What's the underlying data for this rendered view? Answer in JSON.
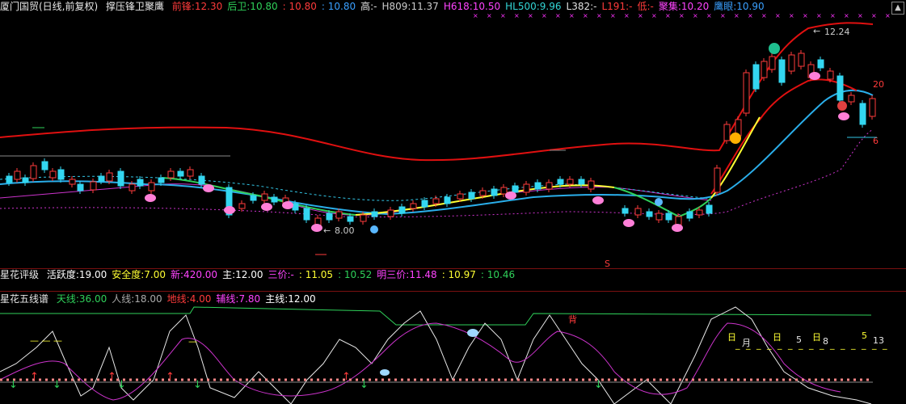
{
  "header": {
    "title": "厦门国贸(日线,前复权)",
    "indicator": "撑压锋卫聚鹰",
    "items": [
      {
        "label": "前锋:",
        "value": "12.30",
        "color": "#ff3b3b"
      },
      {
        "label": "后卫:",
        "value": "10.80",
        "color": "#2fd15a"
      },
      {
        "label": "",
        "value": ": 10.80",
        "color": "#ff3b3b"
      },
      {
        "label": "",
        "value": ": 10.80",
        "color": "#3aa0ff"
      },
      {
        "label": "高:",
        "value": "-",
        "color": "#e0e0e0"
      },
      {
        "label": "H809:",
        "value": "11.37",
        "color": "#cccccc"
      },
      {
        "label": "H618:",
        "value": "10.50",
        "color": "#ff44ff"
      },
      {
        "label": "HL500:",
        "value": "9.96",
        "color": "#33d6d6"
      },
      {
        "label": "L382:",
        "value": "-",
        "color": "#e0e0e0"
      },
      {
        "label": "L191:",
        "value": "-",
        "color": "#ff3b3b"
      },
      {
        "label": "低:",
        "value": "-",
        "color": "#ff3b3b"
      },
      {
        "label": "聚集:",
        "value": "10.20",
        "color": "#ff44ff"
      },
      {
        "label": "鹰眼:",
        "value": "10.90",
        "color": "#3aa0ff"
      }
    ]
  },
  "main_chart": {
    "price_high_label": "12.24",
    "price_low_label": "8.00",
    "right_label_upper": "20",
    "right_label_lower": "6",
    "bottom_marker": "S"
  },
  "sub1": {
    "name": "星花评级",
    "items": [
      {
        "label": "活跃度:",
        "value": "19.00",
        "color": "#ffffff"
      },
      {
        "label": "安全度:",
        "value": "7.00",
        "color": "#ffff33"
      },
      {
        "label": "新:",
        "value": "420.00",
        "color": "#ff44ff"
      },
      {
        "label": "主:",
        "value": "12.00",
        "color": "#ffffff"
      },
      {
        "label": "三价:",
        "value": "-",
        "color": "#ff44ff"
      },
      {
        "label": "",
        "value": ": 11.05",
        "color": "#ffff33"
      },
      {
        "label": "",
        "value": ": 10.52",
        "color": "#2fd15a"
      },
      {
        "label": "明三价:",
        "value": "11.48",
        "color": "#ff44ff"
      },
      {
        "label": "",
        "value": ": 10.97",
        "color": "#ffff33"
      },
      {
        "label": "",
        "value": ": 10.46",
        "color": "#2fd15a"
      }
    ]
  },
  "sub2": {
    "name": "星花五线谱",
    "items": [
      {
        "label": "天线:",
        "value": "36.00",
        "color": "#2fd15a"
      },
      {
        "label": "人线:",
        "value": "18.00",
        "color": "#aaaaaa"
      },
      {
        "label": "地线:",
        "value": "4.00",
        "color": "#ff3b3b"
      },
      {
        "label": "辅线:",
        "value": "7.80",
        "color": "#ff44ff"
      },
      {
        "label": "主线:",
        "value": "12.00",
        "color": "#ffffff"
      }
    ],
    "marker_back": "背",
    "marker_ri": "日",
    "marker_yue": "月",
    "marker_5": "5",
    "marker_8": "8",
    "marker_13": "13"
  }
}
